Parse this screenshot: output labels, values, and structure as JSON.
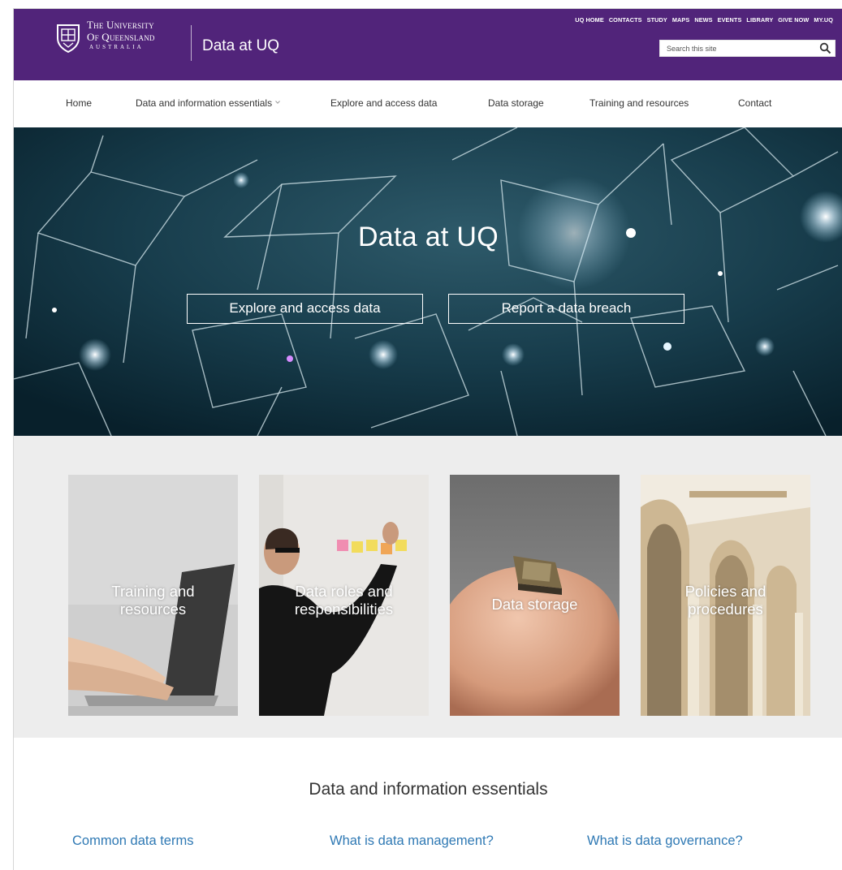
{
  "header": {
    "logo": {
      "line1": "The University",
      "line2": "Of Queensland",
      "line3": "AUSTRALIA"
    },
    "site_title": "Data at UQ",
    "utility_links": [
      "UQ HOME",
      "CONTACTS",
      "STUDY",
      "MAPS",
      "NEWS",
      "EVENTS",
      "LIBRARY",
      "GIVE NOW",
      "MY.UQ"
    ],
    "search": {
      "placeholder": "Search this site",
      "value": ""
    }
  },
  "nav": {
    "items": [
      {
        "label": "Home"
      },
      {
        "label": "Data and information essentials"
      },
      {
        "label": "Explore and access data"
      },
      {
        "label": "Data storage"
      },
      {
        "label": "Training and resources"
      },
      {
        "label": "Contact"
      }
    ]
  },
  "hero": {
    "title": "Data at UQ",
    "buttons": [
      {
        "label": "Explore and access data"
      },
      {
        "label": "Report a data breach"
      }
    ]
  },
  "tiles": [
    {
      "line1": "Training and",
      "line2": "resources"
    },
    {
      "line1": "Data roles and",
      "line2": "responsibilities"
    },
    {
      "line1": "Data storage",
      "line2": ""
    },
    {
      "line1": "Policies and",
      "line2": "procedures"
    }
  ],
  "essentials": {
    "title": "Data and information essentials",
    "links": [
      {
        "label": "Common data terms"
      },
      {
        "label": "What is data management?"
      },
      {
        "label": "What is data governance?"
      }
    ]
  },
  "colors": {
    "brand_purple": "#51247a",
    "link_blue": "#2f79b4",
    "tile_band": "#ededed"
  }
}
